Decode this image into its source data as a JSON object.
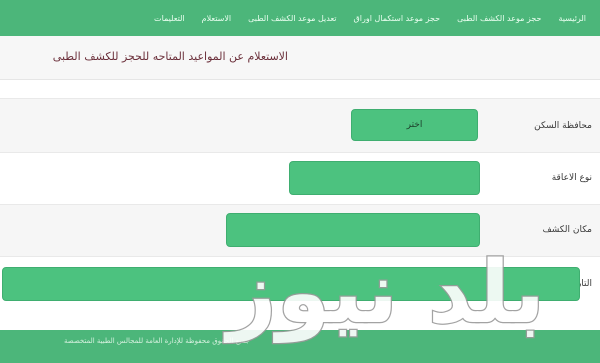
{
  "nav": {
    "items": [
      "الرئيسية",
      "حجز موعد الكشف الطبى",
      "حجز موعد استكمال اوراق",
      "تعديل موعد الكشف الطبى",
      "الاستعلام",
      "التعليمات"
    ]
  },
  "page": {
    "title": "الاستعلام عن المواعيد المتاحه للحجز للكشف الطبى"
  },
  "form": {
    "governorate_label": "محافظة السكن",
    "governorate_value": "اختر",
    "disability_label": "نوع الاعاقة",
    "exam_place_label": "مكان الكشف",
    "date_label": "التاريخ"
  },
  "footer": {
    "text": "جميع الحقوق محفوظة للإدارة العامة للمجالس الطبية المتخصصة"
  },
  "watermark": {
    "text": "بلد نيوز",
    "opacity": 0.9
  },
  "colors": {
    "primary_green": "#4cb67a",
    "field_green": "#4cc27f",
    "title_text": "#6b2f3a"
  }
}
